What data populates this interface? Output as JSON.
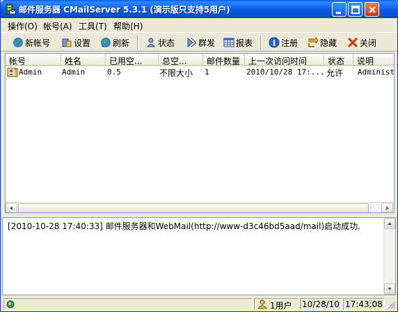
{
  "window": {
    "title": "邮件服务器 CMailServer 5.3.1 (演示版只支持5用户)",
    "icon": "mail-server-app-icon",
    "controls": [
      "minimize-icon",
      "maximize-icon",
      "close-icon"
    ]
  },
  "menu": [
    {
      "label": "操作(O)"
    },
    {
      "label": "帐号(A)"
    },
    {
      "label": "工具(T)"
    },
    {
      "label": "帮助(H)"
    }
  ],
  "toolbar": {
    "new_account": "新帐号",
    "settings": "设置",
    "refresh": "刷新",
    "status": "状态",
    "mass_send": "群发",
    "report": "报表",
    "register": "注册",
    "hide": "隐藏",
    "close": "关闭"
  },
  "table": {
    "columns": [
      "帐号",
      "姓名",
      "已用空...",
      "总空...",
      "邮件数量",
      "上一次访问时间",
      "状态",
      "说明"
    ],
    "rows": [
      {
        "account": "Admin",
        "name": "Admin",
        "used_space": "0.5",
        "total_space": "不限大小",
        "mail_count": "1",
        "last_access": "2010/10/28 17:...",
        "status": "允许",
        "description": "Administr"
      }
    ]
  },
  "log": {
    "lines": [
      "[2010-10-28 17:40:33] 邮件服务器和WebMail(http://www-d3c46bd5aad/mail)启动成功."
    ]
  },
  "statusbar": {
    "users": "1用户",
    "date": "10/28/10",
    "time": "17:43:08"
  },
  "colors": {
    "titlebar": "#0a5ee8",
    "window_bg": "#ece9d8",
    "list_bg": "#ffffff",
    "border": "#7f9db9"
  }
}
